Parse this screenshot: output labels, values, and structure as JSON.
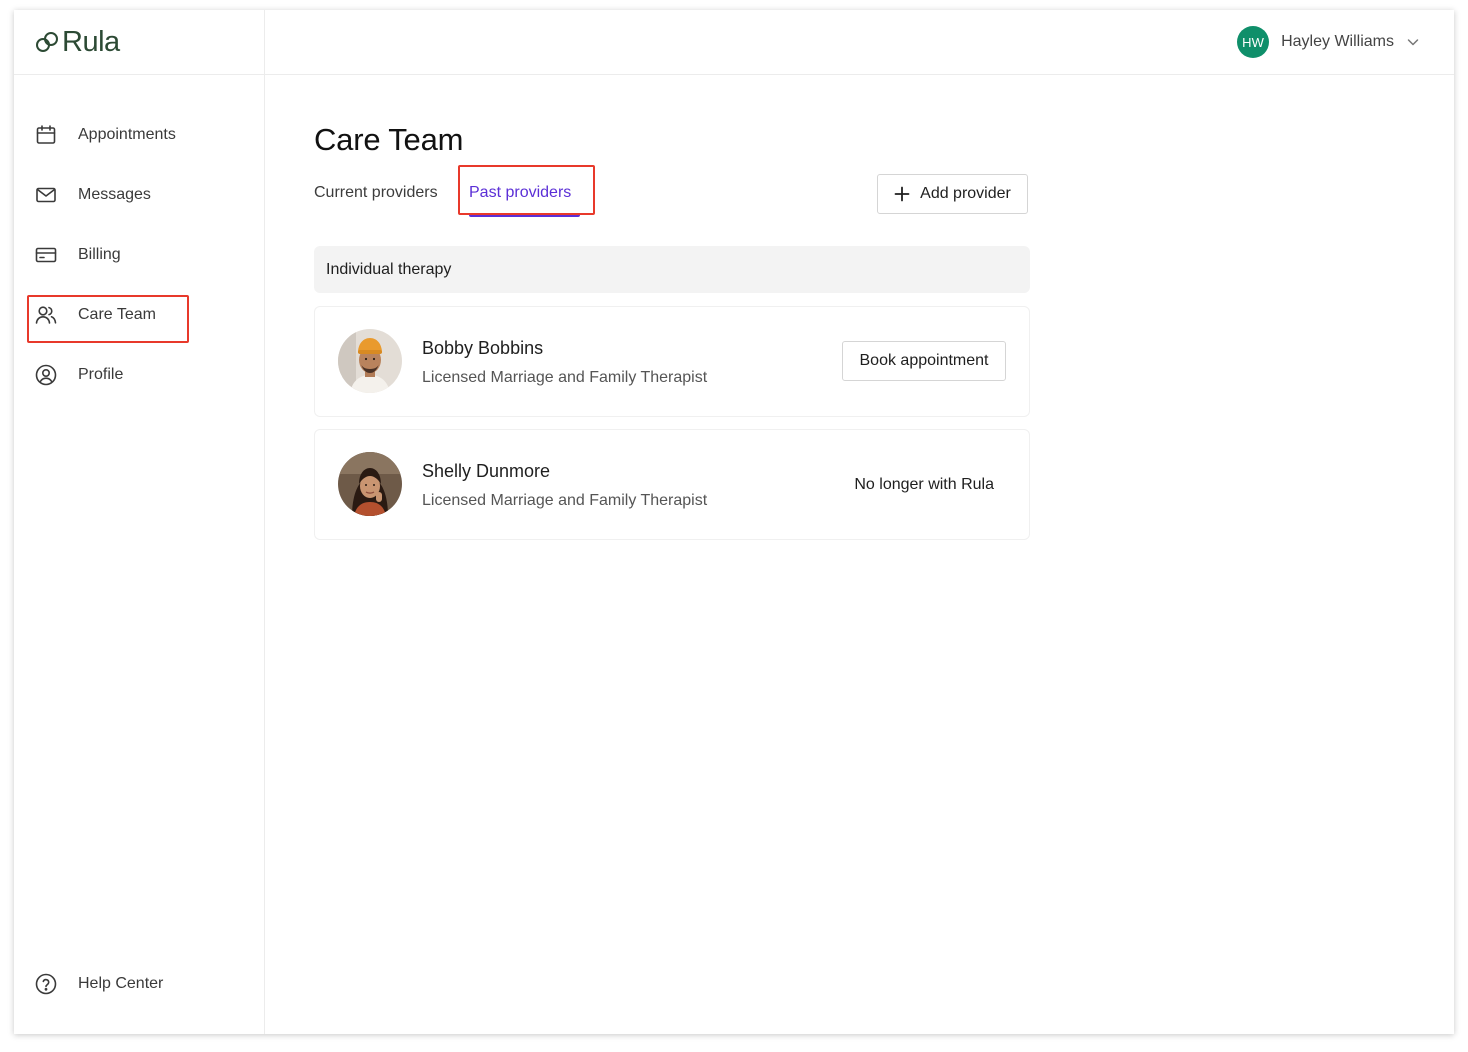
{
  "app": {
    "brand": "Rula"
  },
  "sidebar": {
    "items": [
      {
        "label": "Appointments",
        "icon": "calendar-icon"
      },
      {
        "label": "Messages",
        "icon": "envelope-icon"
      },
      {
        "label": "Billing",
        "icon": "credit-card-icon"
      },
      {
        "label": "Care Team",
        "icon": "users-icon",
        "active": true
      },
      {
        "label": "Profile",
        "icon": "user-circle-icon"
      }
    ],
    "help": {
      "label": "Help Center",
      "icon": "question-circle-icon"
    }
  },
  "header": {
    "user": {
      "initials": "HW",
      "name": "Hayley Williams",
      "avatar_color": "#0f8f6a"
    }
  },
  "main": {
    "title": "Care Team",
    "tabs": [
      {
        "label": "Current providers",
        "active": false
      },
      {
        "label": "Past providers",
        "active": true
      }
    ],
    "add_provider_label": "Add provider",
    "section_title": "Individual therapy",
    "providers": [
      {
        "name": "Bobby Bobbins",
        "role": "Licensed Marriage and Family Therapist",
        "action_label": "Book appointment"
      },
      {
        "name": "Shelly Dunmore",
        "role": "Licensed Marriage and Family Therapist",
        "status": "No longer with Rula"
      }
    ]
  },
  "colors": {
    "accent": "#5b2fd6",
    "highlight": "#e8392b",
    "brand": "#2c4a34"
  }
}
